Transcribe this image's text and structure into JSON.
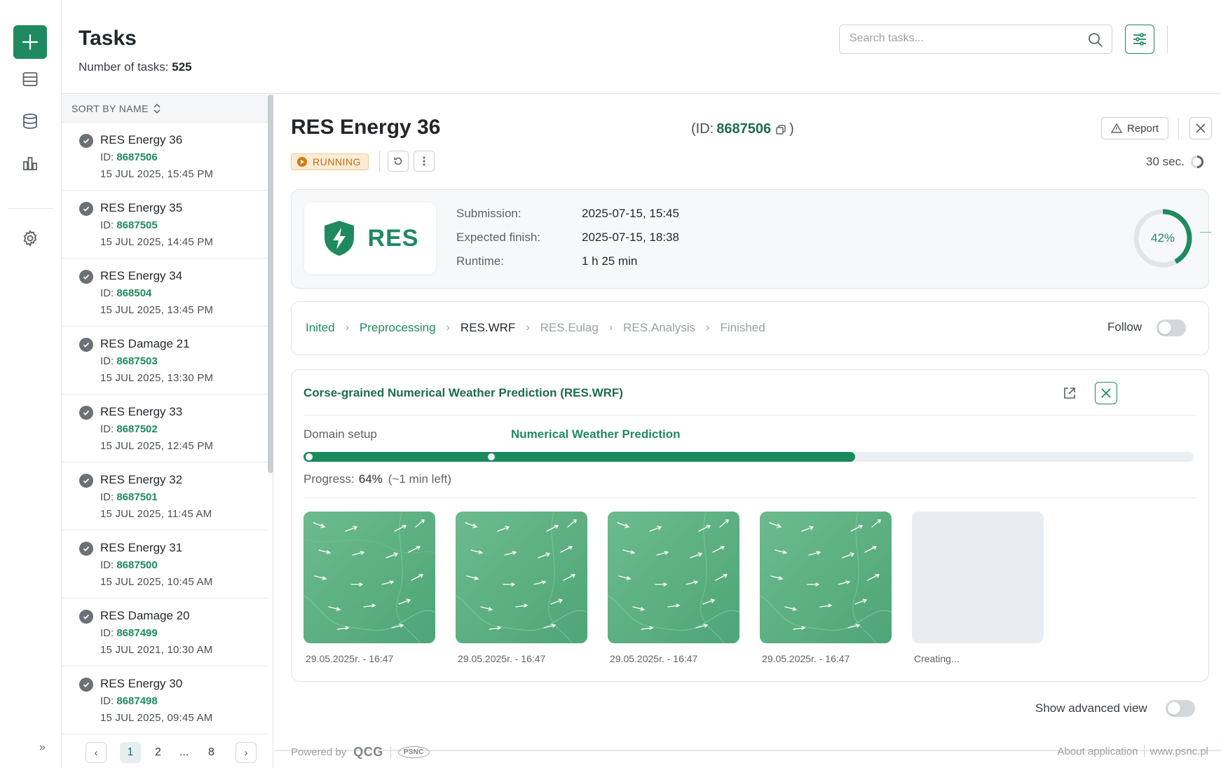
{
  "header": {
    "title": "Tasks",
    "count_label": "Number of tasks:",
    "count_value": "525",
    "search_placeholder": "Search tasks..."
  },
  "sidebar": {
    "icons": [
      "plus-icon",
      "table-icon",
      "database-icon",
      "chart-icon",
      "gear-icon",
      "double-chevron-right-icon"
    ],
    "expand_label": "»"
  },
  "list": {
    "sort_label": "SORT BY NAME",
    "id_label": "ID:",
    "items": [
      {
        "name": "RES Energy 36",
        "id": "8687506",
        "date": "15 JUL 2025, 15:45 PM"
      },
      {
        "name": "RES Energy 35",
        "id": "8687505",
        "date": "15 JUL 2025, 14:45 PM"
      },
      {
        "name": "RES Energy 34",
        "id": "868504",
        "date": "15 JUL 2025, 13:45 PM"
      },
      {
        "name": "RES Damage 21",
        "id": "8687503",
        "date": "15 JUL 2025, 13:30 PM"
      },
      {
        "name": "RES Energy 33",
        "id": "8687502",
        "date": "15 JUL 2025, 12:45 PM"
      },
      {
        "name": "RES Energy 32",
        "id": "8687501",
        "date": "15 JUL 2025, 11:45 AM"
      },
      {
        "name": "RES Energy 31",
        "id": "8687500",
        "date": "15 JUL 2025, 10:45 AM"
      },
      {
        "name": "RES Damage 20",
        "id": "8687499",
        "date": "15 JUL 2021, 10:30 AM"
      },
      {
        "name": "RES Energy 30",
        "id": "8687498",
        "date": "15 JUL 2025, 09:45 AM"
      }
    ],
    "pagination": {
      "pages": [
        "1",
        "2",
        "...",
        "8"
      ],
      "current": "1",
      "prev": "‹",
      "next": "›"
    }
  },
  "detail": {
    "title": "RES Energy  36",
    "id_prefix": "(ID:",
    "id_value": "8687506",
    "id_suffix": ")",
    "report_label": "Report",
    "status": "RUNNING",
    "refresh_interval": "30 sec.",
    "logo_text": "RES",
    "info": [
      {
        "label": "Submission:",
        "value": "2025-07-15, 15:45"
      },
      {
        "label": "Expected finish:",
        "value": "2025-07-15, 18:38"
      },
      {
        "label": "Runtime:",
        "value": "1 h 25 min"
      }
    ],
    "overall_progress": 0.42,
    "overall_progress_label": "42%",
    "steps": [
      {
        "label": "Inited",
        "state": "done"
      },
      {
        "label": "Preprocessing",
        "state": "done"
      },
      {
        "label": "RES.WRF",
        "state": "current"
      },
      {
        "label": "RES.Eulag",
        "state": "future"
      },
      {
        "label": "RES.Analysis",
        "state": "future"
      },
      {
        "label": "Finished",
        "state": "future"
      }
    ],
    "follow_label": "Follow",
    "follow_on": false,
    "stage": {
      "title": "Corse-grained Numerical Weather Prediction (RES.WRF)",
      "substep_1": "Domain setup",
      "substep_2": "Numerical Weather Prediction",
      "bar_fill": 0.62,
      "progress_label": "Progress:",
      "progress_value": "64%",
      "progress_eta": "(~1 min left)",
      "thumbnails": [
        {
          "caption": "29.05.2025r. - 16:47",
          "ready": true
        },
        {
          "caption": "29.05.2025r. - 16:47",
          "ready": true
        },
        {
          "caption": "29.05.2025r. - 16:47",
          "ready": true
        },
        {
          "caption": "29.05.2025r. - 16:47",
          "ready": true
        },
        {
          "caption": "Creating...",
          "ready": false
        }
      ]
    },
    "advanced_view_label": "Show advanced view",
    "advanced_view_on": false
  },
  "footer": {
    "powered_by": "Powered by",
    "brand_1": "QCG",
    "brand_2": "PSNC",
    "about": "About application",
    "site": "www.psnc.pl"
  },
  "colors": {
    "accent": "#1f8a5f",
    "running": "#d57a10",
    "muted": "#9aa1a6"
  }
}
